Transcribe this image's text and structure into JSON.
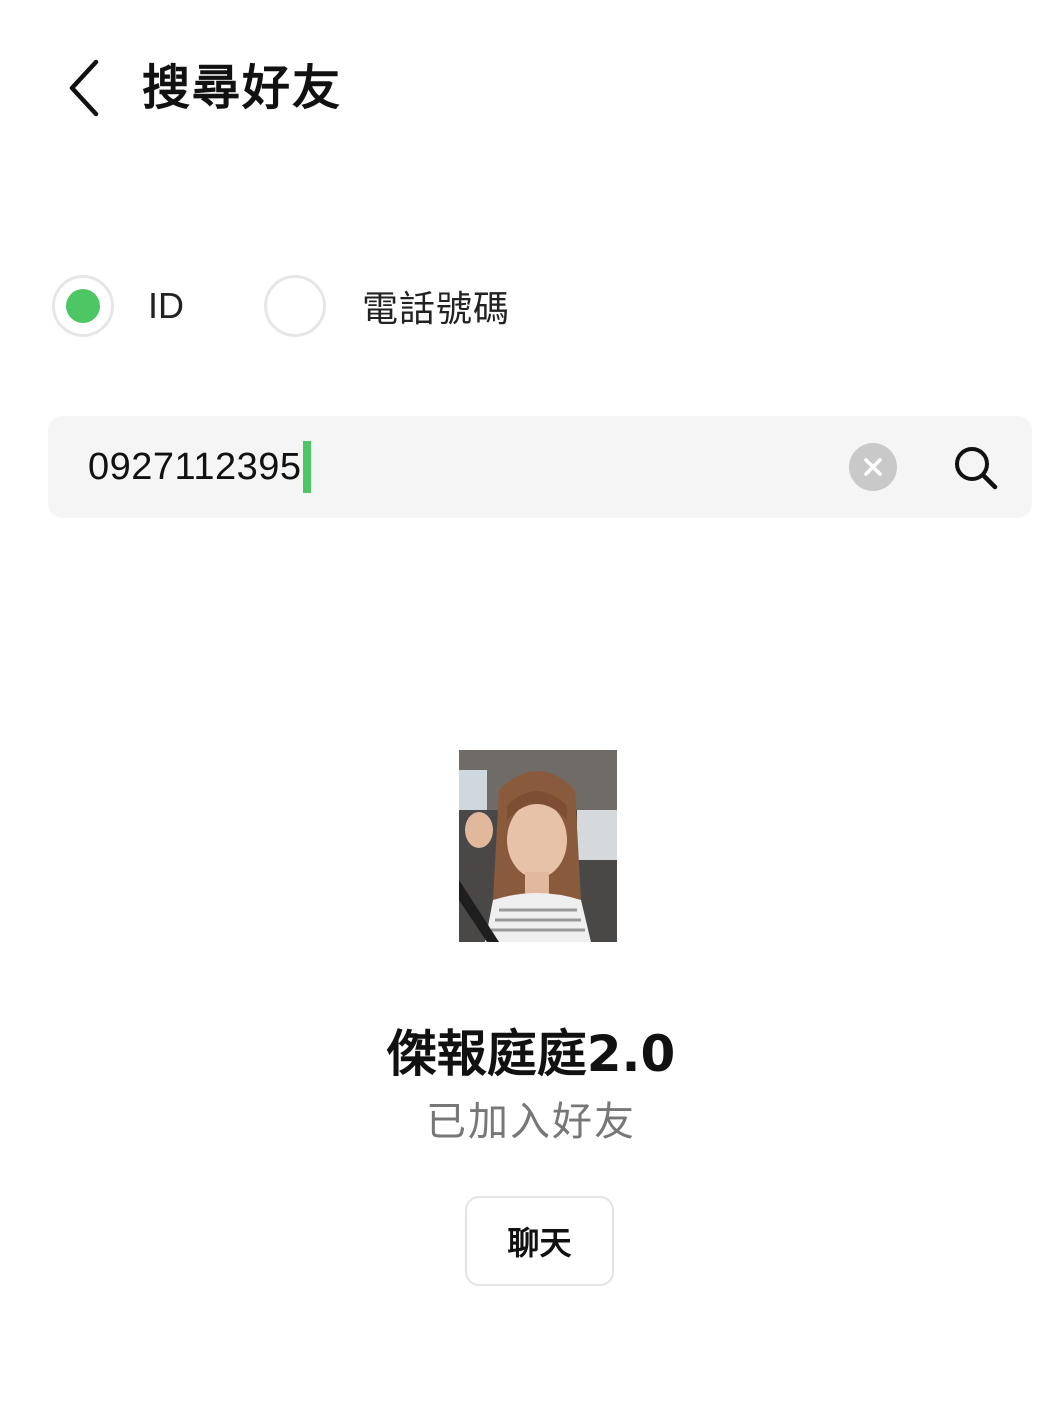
{
  "header": {
    "title": "搜尋好友",
    "back_icon": "chevron-left-icon"
  },
  "search_type": {
    "options": [
      {
        "label": "ID",
        "selected": true
      },
      {
        "label": "電話號碼",
        "selected": false
      }
    ],
    "accent_color": "#4cc764"
  },
  "search": {
    "value": "0927112395",
    "clear_icon": "clear-icon",
    "search_icon": "search-icon"
  },
  "result": {
    "name": "傑報庭庭2.0",
    "status": "已加入好友",
    "chat_label": "聊天"
  }
}
